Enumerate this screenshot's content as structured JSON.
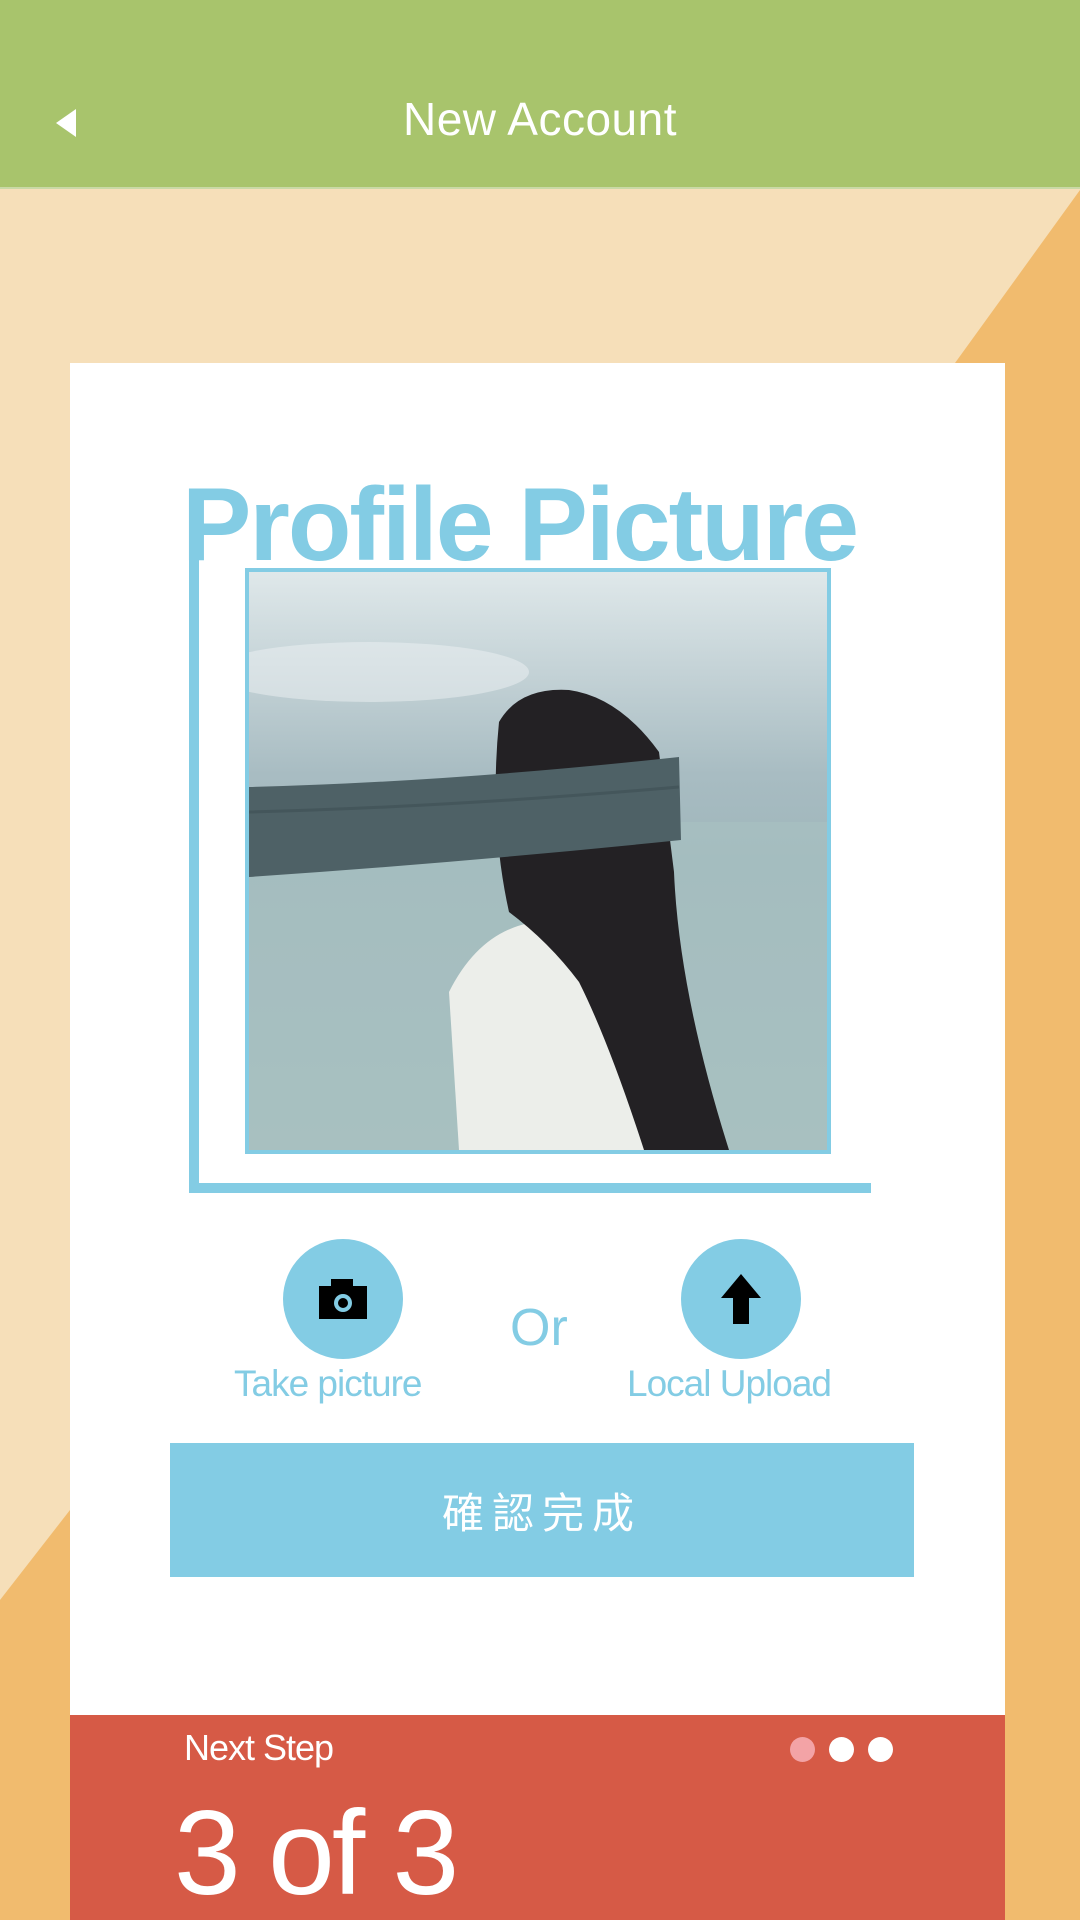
{
  "header": {
    "title": "New Account"
  },
  "card": {
    "title": "Profile Picture",
    "actions": {
      "take_picture_label": "Take picture",
      "or_label": "Or",
      "local_upload_label": "Local Upload"
    },
    "confirm_label": "確認完成"
  },
  "step": {
    "label": "Next Step",
    "count": "3 of 3",
    "current": 1,
    "total": 3
  },
  "icons": {
    "back": "back-arrow-icon",
    "camera": "camera-icon",
    "upload": "upload-arrow-icon"
  },
  "colors": {
    "header": "#a8c46c",
    "accent": "#83cce4",
    "footer": "#d65a46",
    "background_light": "#f6dfb9",
    "background_dark": "#f1bb6e"
  }
}
